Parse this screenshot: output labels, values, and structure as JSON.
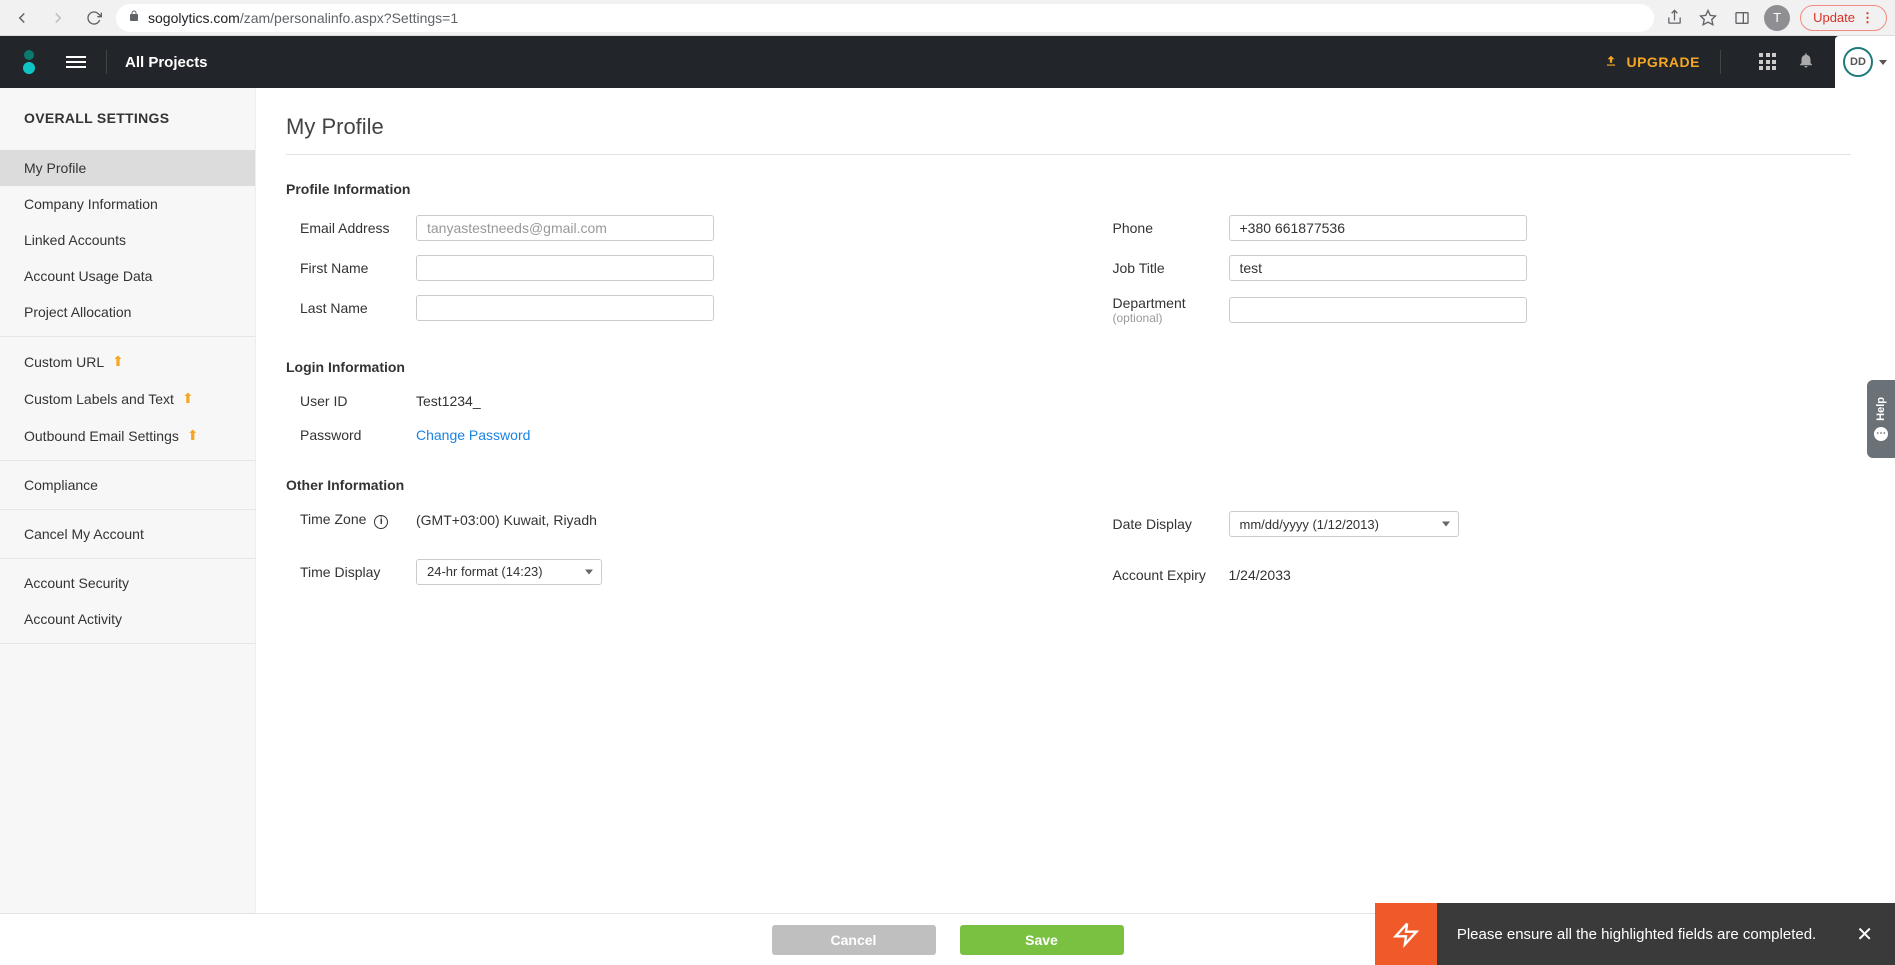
{
  "browser": {
    "url_host": "sogolytics.com",
    "url_path": "/zam/personalinfo.aspx?Settings=1",
    "profile_initial": "T",
    "update_label": "Update"
  },
  "header": {
    "title": "All Projects",
    "upgrade_label": "UPGRADE",
    "avatar_initials": "DD"
  },
  "sidebar": {
    "title": "OVERALL SETTINGS",
    "section1": [
      "My Profile",
      "Company Information",
      "Linked Accounts",
      "Account Usage Data",
      "Project Allocation"
    ],
    "section2": [
      "Custom URL",
      "Custom Labels and Text",
      "Outbound Email Settings"
    ],
    "section3": [
      "Compliance"
    ],
    "section4": [
      "Cancel My Account"
    ],
    "section5": [
      "Account Security",
      "Account Activity"
    ]
  },
  "page": {
    "title": "My Profile",
    "profile": {
      "heading": "Profile Information",
      "labels": {
        "email": "Email Address",
        "first_name": "First Name",
        "last_name": "Last Name",
        "phone": "Phone",
        "job_title": "Job Title",
        "department": "Department",
        "department_sub": "(optional)"
      },
      "values": {
        "email": "tanyastestneeds@gmail.com",
        "first_name": "",
        "last_name": "",
        "phone": "+380 661877536",
        "job_title": "test",
        "department": ""
      }
    },
    "login": {
      "heading": "Login Information",
      "labels": {
        "user_id": "User ID",
        "password": "Password"
      },
      "values": {
        "user_id": "Test1234_",
        "change_password": "Change Password"
      }
    },
    "other": {
      "heading": "Other Information",
      "labels": {
        "time_zone": "Time Zone",
        "time_display": "Time Display",
        "date_display": "Date Display",
        "account_expiry": "Account Expiry"
      },
      "values": {
        "time_zone": "(GMT+03:00) Kuwait, Riyadh",
        "time_display": "24-hr format (14:23)",
        "date_display": "mm/dd/yyyy (1/12/2013)",
        "account_expiry": "1/24/2033"
      }
    }
  },
  "footer": {
    "cancel": "Cancel",
    "save": "Save"
  },
  "toast": {
    "message": "Please ensure all the highlighted fields are completed."
  },
  "help": {
    "label": "Help"
  }
}
